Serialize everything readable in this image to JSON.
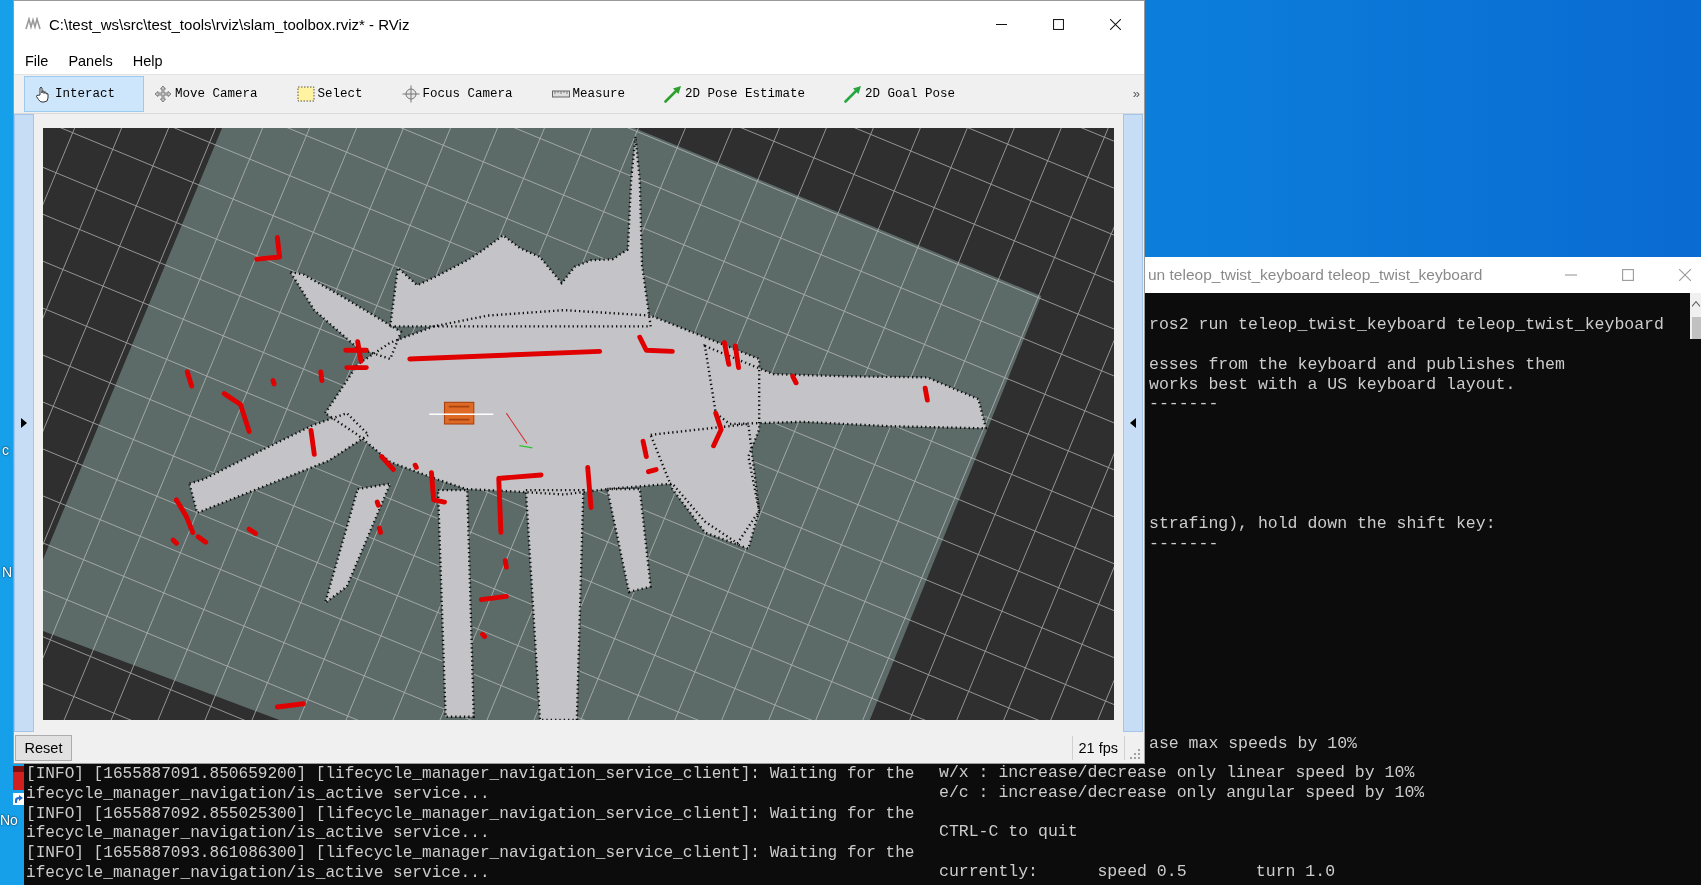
{
  "rviz_window": {
    "title": "C:\\test_ws\\src\\test_tools\\rviz\\slam_toolbox.rviz* - RViz",
    "menu": [
      "File",
      "Panels",
      "Help"
    ],
    "tools": [
      {
        "label": "Interact",
        "kind": "interact",
        "selected": true
      },
      {
        "label": "Move Camera",
        "kind": "move",
        "selected": false
      },
      {
        "label": "Select",
        "kind": "select",
        "selected": false
      },
      {
        "label": "Focus Camera",
        "kind": "focus",
        "selected": false
      },
      {
        "label": "Measure",
        "kind": "measure",
        "selected": false
      },
      {
        "label": "2D Pose Estimate",
        "kind": "pose",
        "selected": false
      },
      {
        "label": "2D Goal Pose",
        "kind": "goal",
        "selected": false
      }
    ],
    "toolbar_overflow": "»",
    "status_bar": {
      "reset_button": "Reset",
      "fps": "21 fps"
    }
  },
  "teleop_terminal": {
    "title": "un teleop_twist_keyboard teleop_twist_keyboard",
    "upper_blocks": [
      [
        "ros2 run teleop_twist_keyboard teleop_twist_keyboard"
      ],
      [
        "esses from the keyboard and publishes them",
        "works best with a US keyboard layout.",
        "-------"
      ],
      [
        "strafing), hold down the shift key:",
        "-------"
      ],
      [
        "ase max speeds by 10%"
      ]
    ],
    "lower_blocks": [
      [
        "w/x : increase/decrease only linear speed by 10%",
        "e/c : increase/decrease only angular speed by 10%"
      ],
      [
        "CTRL-C to quit"
      ]
    ],
    "status_line": [
      "currently:",
      "speed 0.5",
      "turn 1.0"
    ]
  },
  "log_terminal": {
    "lines": [
      "[INFO] [1655887091.850659200] [lifecycle_manager_navigation_service_client]: Waiting for the",
      "ifecycle_manager_navigation/is_active service...",
      "[INFO] [1655887092.855025300] [lifecycle_manager_navigation_service_client]: Waiting for the",
      "ifecycle_manager_navigation/is_active service...",
      "[INFO] [1655887093.861086300] [lifecycle_manager_navigation_service_client]: Waiting for the",
      "ifecycle_manager_navigation/is_active service..."
    ]
  },
  "desktop": {
    "icon_labels": [
      "c",
      "N",
      "No"
    ]
  }
}
